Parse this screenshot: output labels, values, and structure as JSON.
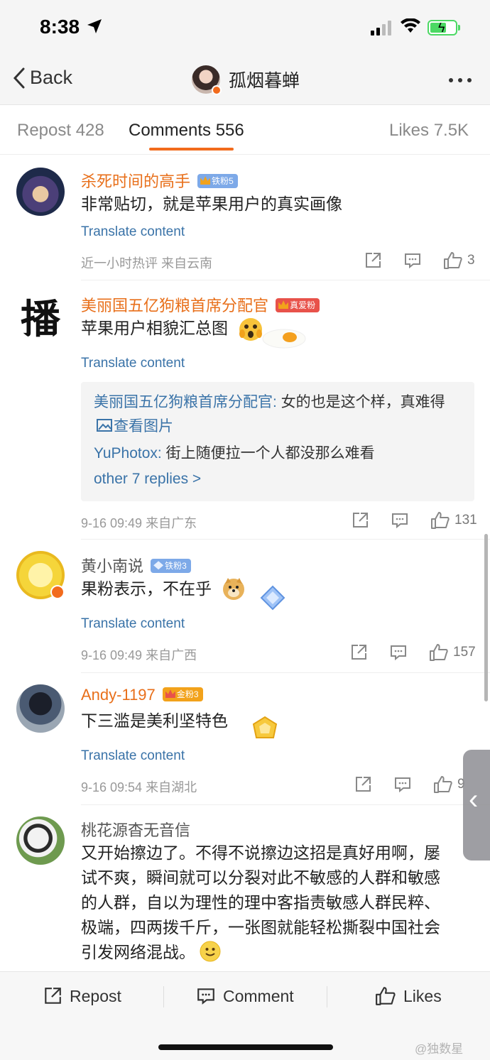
{
  "status_bar": {
    "time": "8:38"
  },
  "nav": {
    "back_label": "Back",
    "title": "孤烟暮蝉"
  },
  "tabs": [
    {
      "label": "Repost 428"
    },
    {
      "label": "Comments 556"
    },
    {
      "label": "Likes 7.5K"
    }
  ],
  "comments": [
    {
      "username": "杀死时间的高手",
      "badge": "铁粉5",
      "text": "非常贴切，就是苹果用户的真实画像",
      "translate": "Translate content",
      "meta": "近一小时热评  来自云南",
      "likes": "3"
    },
    {
      "username": "美丽国五亿狗粮首席分配官",
      "badge": "真爱粉",
      "avatar_char": "播",
      "text": "苹果用户相貌汇总图",
      "translate": "Translate content",
      "replies": [
        {
          "name": "美丽国五亿狗粮首席分配官",
          "text": "女的也是这个样，真难得",
          "link": "查看图片"
        },
        {
          "name": "YuPhotox",
          "text": "街上随便拉一个人都没那么难看"
        }
      ],
      "more_replies": "other 7 replies >",
      "meta": "9-16 09:49  来自广东",
      "likes": "131"
    },
    {
      "username": "黄小南说",
      "badge": "铁粉3",
      "text": "果粉表示，不在乎",
      "translate": "Translate content",
      "meta": "9-16 09:49  来自广西",
      "likes": "157"
    },
    {
      "username": "Andy-1197",
      "badge": "金粉3",
      "text": "下三滥是美利坚特色",
      "translate": "Translate content",
      "meta": "9-16 09:54  来自湖北",
      "likes": "9"
    },
    {
      "username": "桃花源杳无音信",
      "text_lines": [
        "又开始擦边了。不得不说擦边这招是真好用啊，屡",
        "试不爽，瞬间就可以分裂对此不敏感的人群和敏感",
        "的人群，自以为理性的理中客指责敏感人群民粹、",
        "极端，四两拨千斤，一张图就能轻松撕裂中国社会",
        "引发网络混战。"
      ]
    }
  ],
  "bottom_bar": {
    "repost": "Repost",
    "comment": "Comment",
    "likes": "Likes"
  },
  "watermark": "@独数星",
  "colors": {
    "accent": "#f26b1d",
    "link": "#3a73a8",
    "username_orange": "#e86f1a"
  }
}
